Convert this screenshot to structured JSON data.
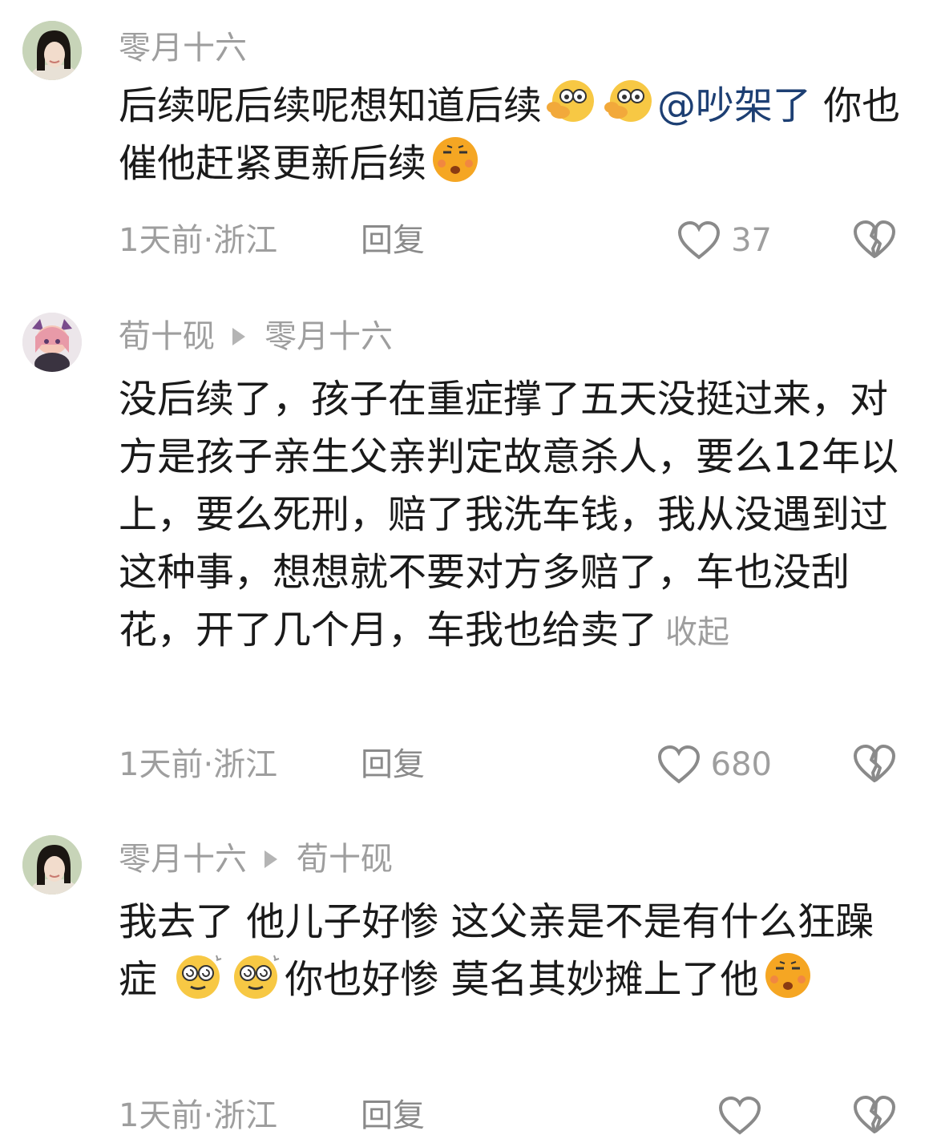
{
  "comments": [
    {
      "author": "零月十六",
      "reply_to": "",
      "text_parts": [
        "后续呢后续呢想知道后续",
        "@吵架了",
        " 你也催他赶紧更新后续"
      ],
      "emojis": [
        "shy-emoji",
        "shy-emoji",
        "smirk-emoji"
      ],
      "time_location": "1天前·浙江",
      "reply_label": "回复",
      "likes": "37"
    },
    {
      "author": "荀十砚",
      "reply_to": "零月十六",
      "text": "没后续了，孩子在重症撑了五天没挺过来，对方是孩子亲生父亲判定故意杀人，要么12年以上，要么死刑，赔了我洗车钱，我从没遇到过这种事，想想就不要对方多赔了，车也没刮花，开了几个月，车我也给卖了",
      "collapse_label": "收起",
      "time_location": "1天前·浙江",
      "reply_label": "回复",
      "likes": "680"
    },
    {
      "author": "零月十六",
      "reply_to": "荀十砚",
      "text_parts": [
        "我去了 他儿子好惨 这父亲是不是有什么狂躁症 ",
        "你也好惨 莫名其妙摊上了他"
      ],
      "emojis": [
        "dizzy-emoji",
        "dizzy-emoji",
        "smirk-emoji"
      ],
      "time_location": "1天前·浙江",
      "reply_label": "回复",
      "likes": ""
    }
  ],
  "colors": {
    "name_gray": "#9e9e9e",
    "mention_blue": "#1d3f73",
    "text": "#1a1a1a"
  }
}
